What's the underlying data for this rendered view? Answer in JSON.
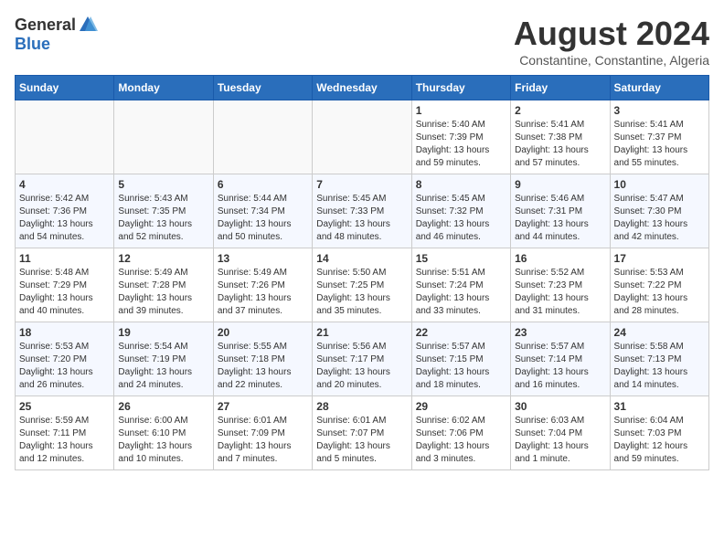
{
  "header": {
    "logo_general": "General",
    "logo_blue": "Blue",
    "month_title": "August 2024",
    "subtitle": "Constantine, Constantine, Algeria"
  },
  "weekdays": [
    "Sunday",
    "Monday",
    "Tuesday",
    "Wednesday",
    "Thursday",
    "Friday",
    "Saturday"
  ],
  "weeks": [
    [
      {
        "day": "",
        "info": ""
      },
      {
        "day": "",
        "info": ""
      },
      {
        "day": "",
        "info": ""
      },
      {
        "day": "",
        "info": ""
      },
      {
        "day": "1",
        "info": "Sunrise: 5:40 AM\nSunset: 7:39 PM\nDaylight: 13 hours\nand 59 minutes."
      },
      {
        "day": "2",
        "info": "Sunrise: 5:41 AM\nSunset: 7:38 PM\nDaylight: 13 hours\nand 57 minutes."
      },
      {
        "day": "3",
        "info": "Sunrise: 5:41 AM\nSunset: 7:37 PM\nDaylight: 13 hours\nand 55 minutes."
      }
    ],
    [
      {
        "day": "4",
        "info": "Sunrise: 5:42 AM\nSunset: 7:36 PM\nDaylight: 13 hours\nand 54 minutes."
      },
      {
        "day": "5",
        "info": "Sunrise: 5:43 AM\nSunset: 7:35 PM\nDaylight: 13 hours\nand 52 minutes."
      },
      {
        "day": "6",
        "info": "Sunrise: 5:44 AM\nSunset: 7:34 PM\nDaylight: 13 hours\nand 50 minutes."
      },
      {
        "day": "7",
        "info": "Sunrise: 5:45 AM\nSunset: 7:33 PM\nDaylight: 13 hours\nand 48 minutes."
      },
      {
        "day": "8",
        "info": "Sunrise: 5:45 AM\nSunset: 7:32 PM\nDaylight: 13 hours\nand 46 minutes."
      },
      {
        "day": "9",
        "info": "Sunrise: 5:46 AM\nSunset: 7:31 PM\nDaylight: 13 hours\nand 44 minutes."
      },
      {
        "day": "10",
        "info": "Sunrise: 5:47 AM\nSunset: 7:30 PM\nDaylight: 13 hours\nand 42 minutes."
      }
    ],
    [
      {
        "day": "11",
        "info": "Sunrise: 5:48 AM\nSunset: 7:29 PM\nDaylight: 13 hours\nand 40 minutes."
      },
      {
        "day": "12",
        "info": "Sunrise: 5:49 AM\nSunset: 7:28 PM\nDaylight: 13 hours\nand 39 minutes."
      },
      {
        "day": "13",
        "info": "Sunrise: 5:49 AM\nSunset: 7:26 PM\nDaylight: 13 hours\nand 37 minutes."
      },
      {
        "day": "14",
        "info": "Sunrise: 5:50 AM\nSunset: 7:25 PM\nDaylight: 13 hours\nand 35 minutes."
      },
      {
        "day": "15",
        "info": "Sunrise: 5:51 AM\nSunset: 7:24 PM\nDaylight: 13 hours\nand 33 minutes."
      },
      {
        "day": "16",
        "info": "Sunrise: 5:52 AM\nSunset: 7:23 PM\nDaylight: 13 hours\nand 31 minutes."
      },
      {
        "day": "17",
        "info": "Sunrise: 5:53 AM\nSunset: 7:22 PM\nDaylight: 13 hours\nand 28 minutes."
      }
    ],
    [
      {
        "day": "18",
        "info": "Sunrise: 5:53 AM\nSunset: 7:20 PM\nDaylight: 13 hours\nand 26 minutes."
      },
      {
        "day": "19",
        "info": "Sunrise: 5:54 AM\nSunset: 7:19 PM\nDaylight: 13 hours\nand 24 minutes."
      },
      {
        "day": "20",
        "info": "Sunrise: 5:55 AM\nSunset: 7:18 PM\nDaylight: 13 hours\nand 22 minutes."
      },
      {
        "day": "21",
        "info": "Sunrise: 5:56 AM\nSunset: 7:17 PM\nDaylight: 13 hours\nand 20 minutes."
      },
      {
        "day": "22",
        "info": "Sunrise: 5:57 AM\nSunset: 7:15 PM\nDaylight: 13 hours\nand 18 minutes."
      },
      {
        "day": "23",
        "info": "Sunrise: 5:57 AM\nSunset: 7:14 PM\nDaylight: 13 hours\nand 16 minutes."
      },
      {
        "day": "24",
        "info": "Sunrise: 5:58 AM\nSunset: 7:13 PM\nDaylight: 13 hours\nand 14 minutes."
      }
    ],
    [
      {
        "day": "25",
        "info": "Sunrise: 5:59 AM\nSunset: 7:11 PM\nDaylight: 13 hours\nand 12 minutes."
      },
      {
        "day": "26",
        "info": "Sunrise: 6:00 AM\nSunset: 6:10 PM\nDaylight: 13 hours\nand 10 minutes."
      },
      {
        "day": "27",
        "info": "Sunrise: 6:01 AM\nSunset: 7:09 PM\nDaylight: 13 hours\nand 7 minutes."
      },
      {
        "day": "28",
        "info": "Sunrise: 6:01 AM\nSunset: 7:07 PM\nDaylight: 13 hours\nand 5 minutes."
      },
      {
        "day": "29",
        "info": "Sunrise: 6:02 AM\nSunset: 7:06 PM\nDaylight: 13 hours\nand 3 minutes."
      },
      {
        "day": "30",
        "info": "Sunrise: 6:03 AM\nSunset: 7:04 PM\nDaylight: 13 hours\nand 1 minute."
      },
      {
        "day": "31",
        "info": "Sunrise: 6:04 AM\nSunset: 7:03 PM\nDaylight: 12 hours\nand 59 minutes."
      }
    ]
  ]
}
